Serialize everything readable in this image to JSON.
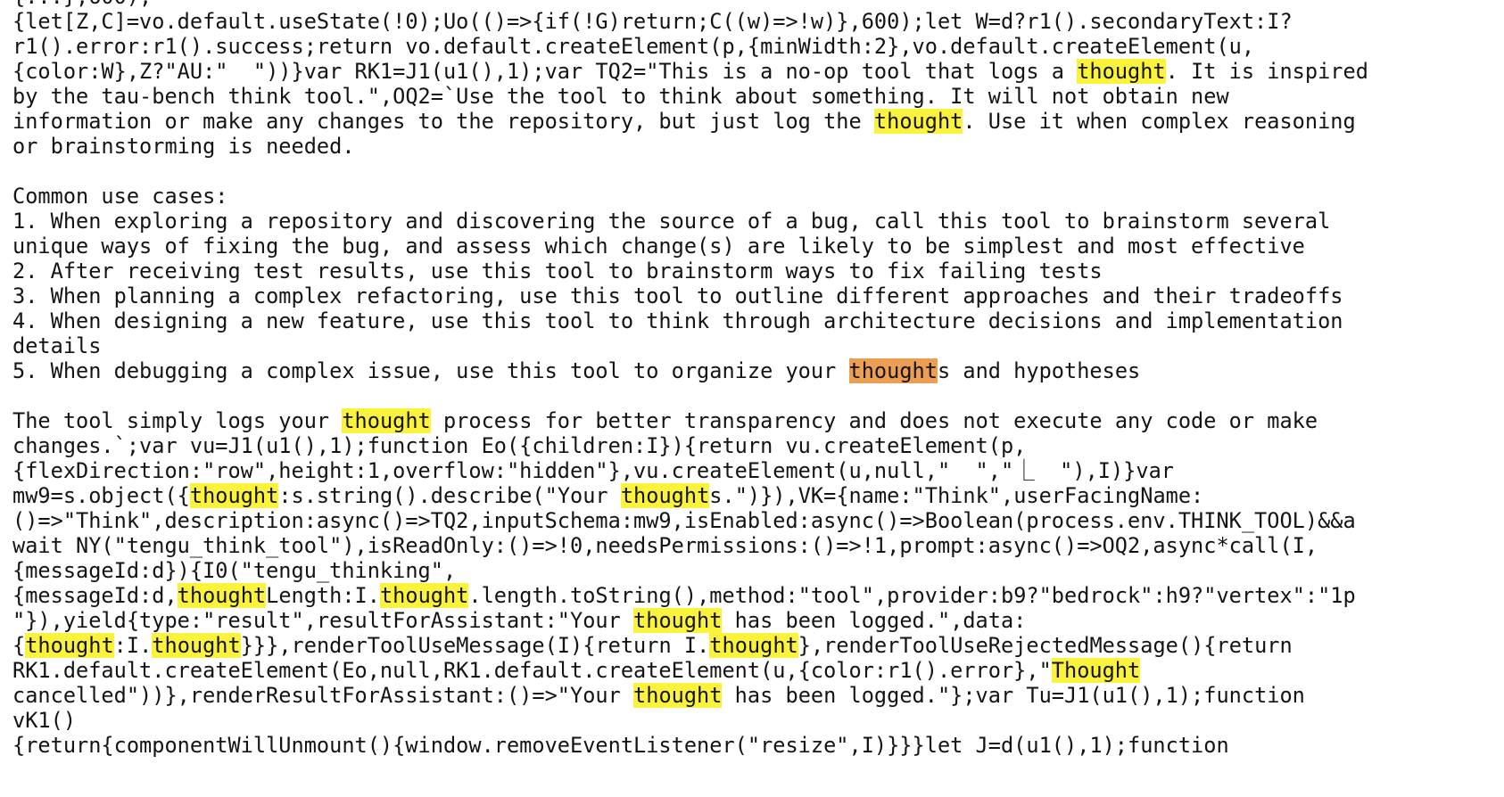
{
  "search": {
    "term": "thought",
    "current_match_index": 8,
    "colors": {
      "match": "#fbf33b",
      "current_match": "#ec9e52",
      "text": "#141414",
      "background": "#ffffff"
    }
  },
  "document": {
    "lines": [
      [
        "{...},600);"
      ],
      [
        "{let[Z,C]=vo.default.useState(!0);Uo(()=>{if(!G)return;C((w)=>!w)},600);let W=d?r1().secondaryText:I?"
      ],
      [
        "r1().error:r1().success;return vo.default.createElement(p,{minWidth:2},vo.default.createElement(u,"
      ],
      [
        "{color:W},Z?\"AU:\"  \"))}var RK1=J1(u1(),1);var TQ2=\"This is a no-op tool that logs a ",
        {
          "m": "thought"
        },
        ". It is inspired"
      ],
      [
        "by the tau-bench think tool.\",OQ2=`Use the tool to think about something. It will not obtain new"
      ],
      [
        "information or make any changes to the repository, but just log the ",
        {
          "m": "thought"
        },
        ". Use it when complex reasoning"
      ],
      [
        "or brainstorming is needed."
      ],
      [
        ""
      ],
      [
        "Common use cases:"
      ],
      [
        "1. When exploring a repository and discovering the source of a bug, call this tool to brainstorm several"
      ],
      [
        "unique ways of fixing the bug, and assess which change(s) are likely to be simplest and most effective"
      ],
      [
        "2. After receiving test results, use this tool to brainstorm ways to fix failing tests"
      ],
      [
        "3. When planning a complex refactoring, use this tool to outline different approaches and their tradeoffs"
      ],
      [
        "4. When designing a new feature, use this tool to think through architecture decisions and implementation"
      ],
      [
        "details"
      ],
      [
        "5. When debugging a complex issue, use this tool to organize your ",
        {
          "m": "thought",
          "current": true
        },
        "s and hypotheses"
      ],
      [
        ""
      ],
      [
        "The tool simply logs your ",
        {
          "m": "thought"
        },
        " process for better transparency and does not execute any code or make"
      ],
      [
        "changes.`;var vu=J1(u1(),1);function Eo({children:I}){return vu.createElement(p,"
      ],
      [
        "{flexDirection:\"row\",height:1,overflow:\"hidden\"},vu.createElement(u,null,\"  \",\"⎿  \"),I)}var"
      ],
      [
        "mw9=s.object({",
        {
          "m": "thought"
        },
        ":s.string().describe(\"Your ",
        {
          "m": "thought"
        },
        "s.\")}),VK={name:\"Think\",userFacingName:"
      ],
      [
        "()=>\"Think\",description:async()=>TQ2,inputSchema:mw9,isEnabled:async()=>Boolean(process.env.THINK_TOOL)&&a"
      ],
      [
        "wait NY(\"tengu_think_tool\"),isReadOnly:()=>!0,needsPermissions:()=>!1,prompt:async()=>OQ2,async*call(I,"
      ],
      [
        "{messageId:d}){I0(\"tengu_thinking\","
      ],
      [
        "{messageId:d,",
        {
          "m": "thought"
        },
        "Length:I.",
        {
          "m": "thought"
        },
        ".length.toString(),method:\"tool\",provider:b9?\"bedrock\":h9?\"vertex\":\"1p"
      ],
      [
        "\"}),yield{type:\"result\",resultForAssistant:\"Your ",
        {
          "m": "thought"
        },
        " has been logged.\",data:"
      ],
      [
        "{",
        {
          "m": "thought"
        },
        ":I.",
        {
          "m": "thought"
        },
        "}}},renderToolUseMessage(I){return I.",
        {
          "m": "thought"
        },
        "},renderToolUseRejectedMessage(){return"
      ],
      [
        "RK1.default.createElement(Eo,null,RK1.default.createElement(u,{color:r1().error},\"",
        {
          "m": "Thought"
        }
      ],
      [
        "cancelled\"))},renderResultForAssistant:()=>\"Your ",
        {
          "m": "thought"
        },
        " has been logged.\"};var Tu=J1(u1(),1);function"
      ],
      [
        "vK1()"
      ],
      [
        "{return{componentWillUnmount(){window.removeEventListener(\"resize\",I)}}}let J=d(u1(),1);function"
      ]
    ]
  }
}
